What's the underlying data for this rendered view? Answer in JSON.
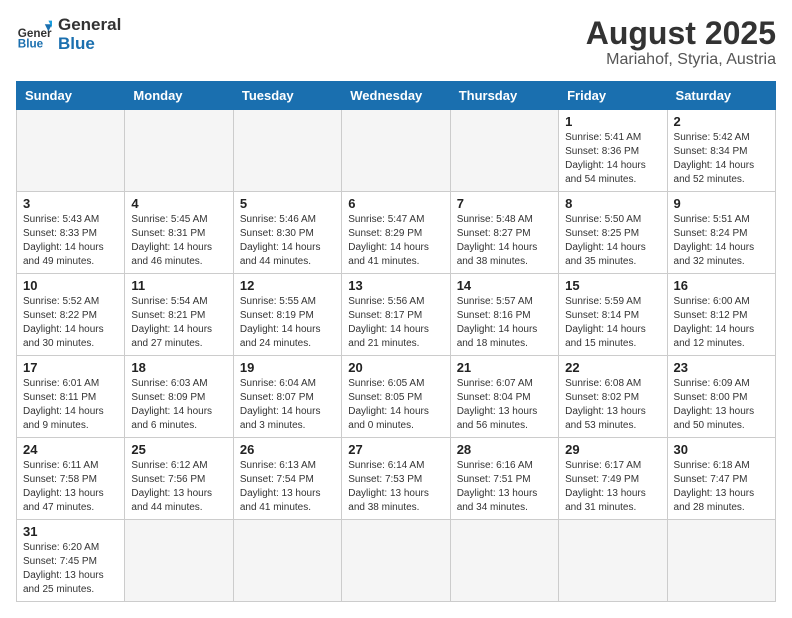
{
  "header": {
    "logo_general": "General",
    "logo_blue": "Blue",
    "month_year": "August 2025",
    "location": "Mariahof, Styria, Austria"
  },
  "weekdays": [
    "Sunday",
    "Monday",
    "Tuesday",
    "Wednesday",
    "Thursday",
    "Friday",
    "Saturday"
  ],
  "weeks": [
    [
      {
        "day": "",
        "info": ""
      },
      {
        "day": "",
        "info": ""
      },
      {
        "day": "",
        "info": ""
      },
      {
        "day": "",
        "info": ""
      },
      {
        "day": "",
        "info": ""
      },
      {
        "day": "1",
        "info": "Sunrise: 5:41 AM\nSunset: 8:36 PM\nDaylight: 14 hours\nand 54 minutes."
      },
      {
        "day": "2",
        "info": "Sunrise: 5:42 AM\nSunset: 8:34 PM\nDaylight: 14 hours\nand 52 minutes."
      }
    ],
    [
      {
        "day": "3",
        "info": "Sunrise: 5:43 AM\nSunset: 8:33 PM\nDaylight: 14 hours\nand 49 minutes."
      },
      {
        "day": "4",
        "info": "Sunrise: 5:45 AM\nSunset: 8:31 PM\nDaylight: 14 hours\nand 46 minutes."
      },
      {
        "day": "5",
        "info": "Sunrise: 5:46 AM\nSunset: 8:30 PM\nDaylight: 14 hours\nand 44 minutes."
      },
      {
        "day": "6",
        "info": "Sunrise: 5:47 AM\nSunset: 8:29 PM\nDaylight: 14 hours\nand 41 minutes."
      },
      {
        "day": "7",
        "info": "Sunrise: 5:48 AM\nSunset: 8:27 PM\nDaylight: 14 hours\nand 38 minutes."
      },
      {
        "day": "8",
        "info": "Sunrise: 5:50 AM\nSunset: 8:25 PM\nDaylight: 14 hours\nand 35 minutes."
      },
      {
        "day": "9",
        "info": "Sunrise: 5:51 AM\nSunset: 8:24 PM\nDaylight: 14 hours\nand 32 minutes."
      }
    ],
    [
      {
        "day": "10",
        "info": "Sunrise: 5:52 AM\nSunset: 8:22 PM\nDaylight: 14 hours\nand 30 minutes."
      },
      {
        "day": "11",
        "info": "Sunrise: 5:54 AM\nSunset: 8:21 PM\nDaylight: 14 hours\nand 27 minutes."
      },
      {
        "day": "12",
        "info": "Sunrise: 5:55 AM\nSunset: 8:19 PM\nDaylight: 14 hours\nand 24 minutes."
      },
      {
        "day": "13",
        "info": "Sunrise: 5:56 AM\nSunset: 8:17 PM\nDaylight: 14 hours\nand 21 minutes."
      },
      {
        "day": "14",
        "info": "Sunrise: 5:57 AM\nSunset: 8:16 PM\nDaylight: 14 hours\nand 18 minutes."
      },
      {
        "day": "15",
        "info": "Sunrise: 5:59 AM\nSunset: 8:14 PM\nDaylight: 14 hours\nand 15 minutes."
      },
      {
        "day": "16",
        "info": "Sunrise: 6:00 AM\nSunset: 8:12 PM\nDaylight: 14 hours\nand 12 minutes."
      }
    ],
    [
      {
        "day": "17",
        "info": "Sunrise: 6:01 AM\nSunset: 8:11 PM\nDaylight: 14 hours\nand 9 minutes."
      },
      {
        "day": "18",
        "info": "Sunrise: 6:03 AM\nSunset: 8:09 PM\nDaylight: 14 hours\nand 6 minutes."
      },
      {
        "day": "19",
        "info": "Sunrise: 6:04 AM\nSunset: 8:07 PM\nDaylight: 14 hours\nand 3 minutes."
      },
      {
        "day": "20",
        "info": "Sunrise: 6:05 AM\nSunset: 8:05 PM\nDaylight: 14 hours\nand 0 minutes."
      },
      {
        "day": "21",
        "info": "Sunrise: 6:07 AM\nSunset: 8:04 PM\nDaylight: 13 hours\nand 56 minutes."
      },
      {
        "day": "22",
        "info": "Sunrise: 6:08 AM\nSunset: 8:02 PM\nDaylight: 13 hours\nand 53 minutes."
      },
      {
        "day": "23",
        "info": "Sunrise: 6:09 AM\nSunset: 8:00 PM\nDaylight: 13 hours\nand 50 minutes."
      }
    ],
    [
      {
        "day": "24",
        "info": "Sunrise: 6:11 AM\nSunset: 7:58 PM\nDaylight: 13 hours\nand 47 minutes."
      },
      {
        "day": "25",
        "info": "Sunrise: 6:12 AM\nSunset: 7:56 PM\nDaylight: 13 hours\nand 44 minutes."
      },
      {
        "day": "26",
        "info": "Sunrise: 6:13 AM\nSunset: 7:54 PM\nDaylight: 13 hours\nand 41 minutes."
      },
      {
        "day": "27",
        "info": "Sunrise: 6:14 AM\nSunset: 7:53 PM\nDaylight: 13 hours\nand 38 minutes."
      },
      {
        "day": "28",
        "info": "Sunrise: 6:16 AM\nSunset: 7:51 PM\nDaylight: 13 hours\nand 34 minutes."
      },
      {
        "day": "29",
        "info": "Sunrise: 6:17 AM\nSunset: 7:49 PM\nDaylight: 13 hours\nand 31 minutes."
      },
      {
        "day": "30",
        "info": "Sunrise: 6:18 AM\nSunset: 7:47 PM\nDaylight: 13 hours\nand 28 minutes."
      }
    ],
    [
      {
        "day": "31",
        "info": "Sunrise: 6:20 AM\nSunset: 7:45 PM\nDaylight: 13 hours\nand 25 minutes."
      },
      {
        "day": "",
        "info": ""
      },
      {
        "day": "",
        "info": ""
      },
      {
        "day": "",
        "info": ""
      },
      {
        "day": "",
        "info": ""
      },
      {
        "day": "",
        "info": ""
      },
      {
        "day": "",
        "info": ""
      }
    ]
  ]
}
